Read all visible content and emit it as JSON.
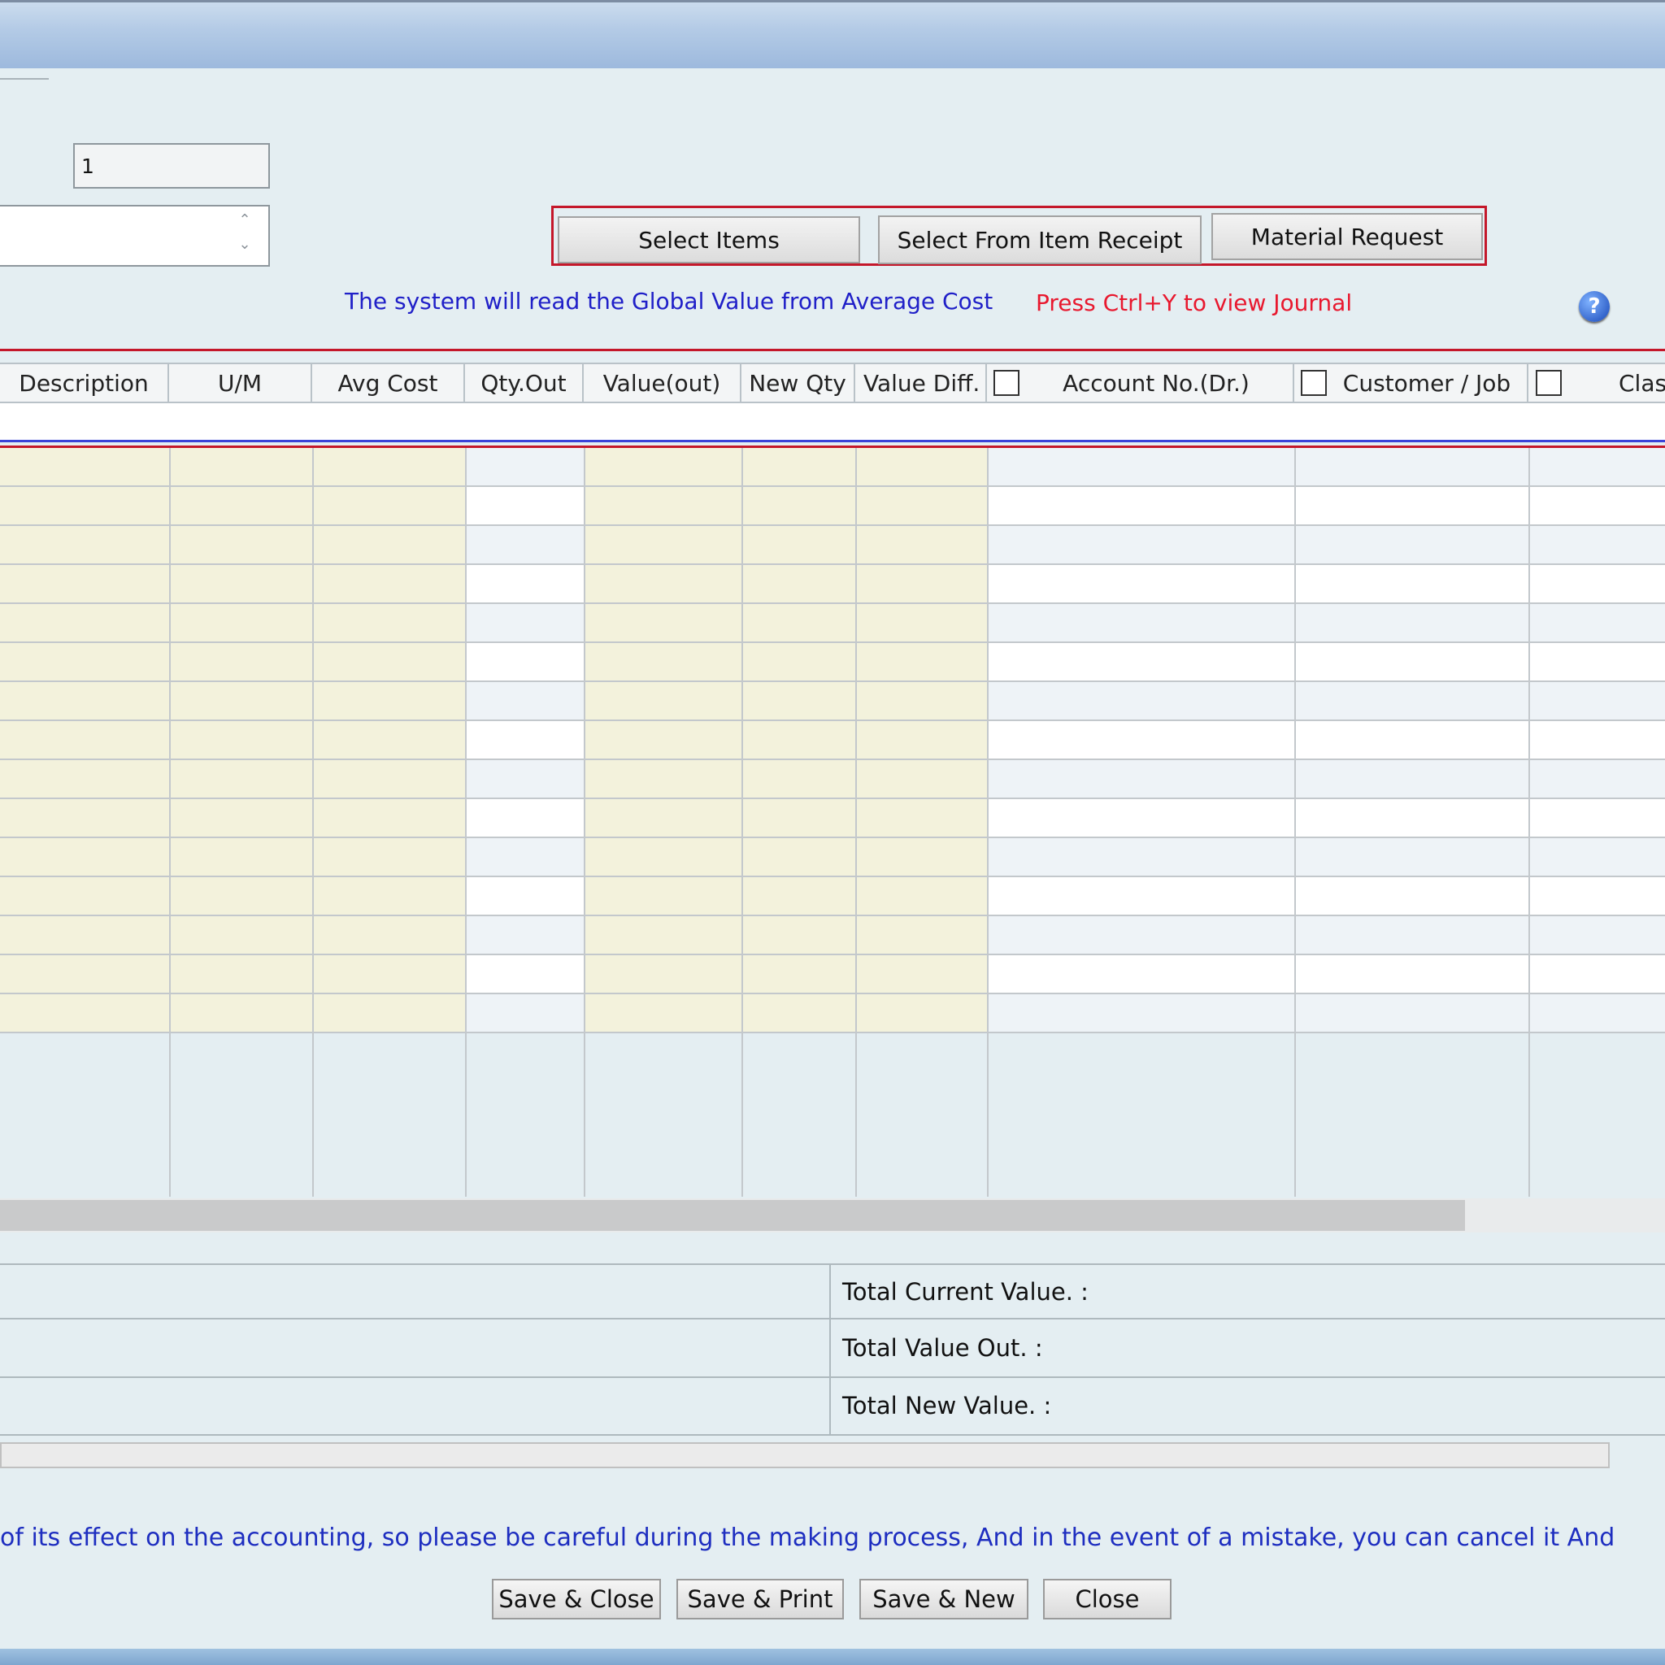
{
  "form": {
    "number_value": "1",
    "buttons": {
      "select_items": "Select Items",
      "select_from_item_receipt": "Select From Item Receipt",
      "material_request": "Material Request"
    },
    "note_global_value": "The system will read the Global Value from Average Cost",
    "note_journal": "Press Ctrl+Y to view Journal",
    "help_icon": "question-circle-icon"
  },
  "grid": {
    "columns": {
      "description": "Description",
      "um": "U/M",
      "avg_cost": "Avg Cost",
      "qty_out": "Qty.Out",
      "value_out": "Value(out)",
      "new_qty": "New Qty",
      "value_diff": "Value Diff.",
      "account_no": "Account No.(Dr.)",
      "customer_job": "Customer / Job",
      "class": "Clas"
    },
    "row_count": 15
  },
  "totals": {
    "current_value_label": "Total Current Value. :",
    "value_out_label": "Total Value Out. :",
    "new_value_label": "Total New Value. :"
  },
  "footer": {
    "note": "of its effect on the accounting, so please be careful during the making process, And in the event of a mistake, you can cancel it And",
    "buttons": {
      "save_close": "Save & Close",
      "save_print": "Save & Print",
      "save_new": "Save & New",
      "close": "Close"
    }
  },
  "colors": {
    "readonly_cell": "#f3f2dc",
    "alt_row": "#eef3f7",
    "highlight_border": "#c4172a",
    "note_blue": "#2020c8",
    "note_red": "#e8182e"
  }
}
